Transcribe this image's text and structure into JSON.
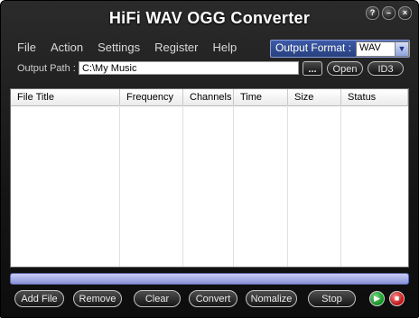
{
  "window": {
    "title": "HiFi WAV OGG Converter",
    "controls": {
      "help": "?",
      "minimize": "–",
      "close": "×"
    }
  },
  "menu": {
    "items": [
      "File",
      "Action",
      "Settings",
      "Register",
      "Help"
    ]
  },
  "output_format": {
    "label": "Output Format :",
    "value": "WAV",
    "arrow": "▼"
  },
  "output_path": {
    "label": "Output Path :",
    "value": "C:\\My Music",
    "browse": "...",
    "open": "Open",
    "id3": "ID3"
  },
  "table": {
    "columns": [
      "File Title",
      "Frequency",
      "Channels",
      "Time",
      "Size",
      "Status"
    ],
    "rows": []
  },
  "progress": {
    "value": 0
  },
  "buttons": {
    "add_file": "Add File",
    "remove": "Remove",
    "clear": "Clear",
    "convert": "Convert",
    "normalize": "Nomalize",
    "stop": "Stop"
  },
  "media": {
    "play_icon": "▶",
    "stop_icon": "■"
  },
  "colors": {
    "accent": "#3d5aa8",
    "progress_fill": "#8a92d8",
    "play": "#1aa02e",
    "stop": "#c01818"
  }
}
